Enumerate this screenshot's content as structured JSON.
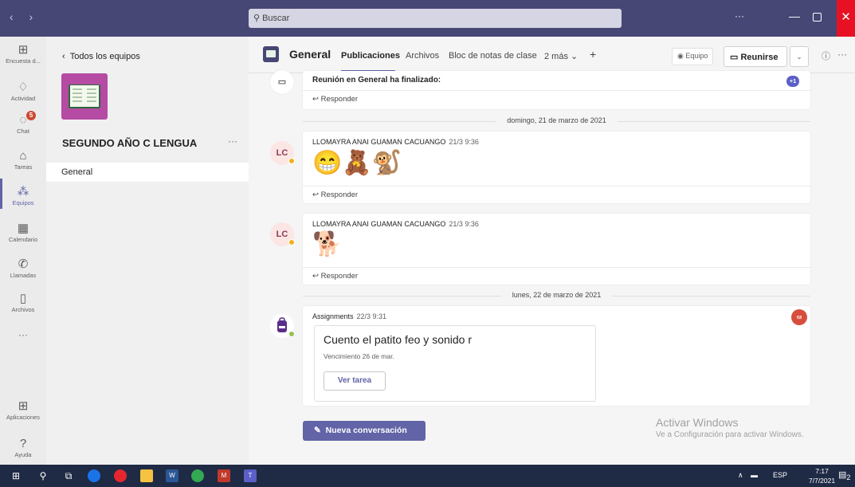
{
  "titlebar": {
    "nav": "‹ ›",
    "search_placeholder": "Buscar",
    "dots": "···",
    "minimize": "—",
    "close": "✕"
  },
  "rail": {
    "items": [
      {
        "label": "Encuesta d...",
        "icon": "apps-grid-icon"
      },
      {
        "label": "Actividad",
        "icon": "bell-icon"
      },
      {
        "label": "Chat",
        "icon": "chat-icon",
        "badge": "5"
      },
      {
        "label": "Tareas",
        "icon": "backpack-icon"
      },
      {
        "label": "Equipos",
        "icon": "teams-icon"
      },
      {
        "label": "Calendario",
        "icon": "calendar-icon"
      },
      {
        "label": "Llamadas",
        "icon": "phone-icon"
      },
      {
        "label": "Archivos",
        "icon": "file-icon"
      },
      {
        "label": "···",
        "icon": "more-icon"
      },
      {
        "label": "Aplicaciones",
        "icon": "apps-icon"
      },
      {
        "label": "Ayuda",
        "icon": "help-icon"
      }
    ]
  },
  "sidebar": {
    "back_label": "Todos los equipos",
    "team_name": "SEGUNDO AÑO C LENGUA",
    "more": "···",
    "channel": "General"
  },
  "header": {
    "title": "General",
    "tabs": [
      "Publicaciones",
      "Archivos",
      "Bloc de notas de clase",
      "2 más ⌄",
      "+"
    ],
    "team_button": "Equipo",
    "meet_button": "Reunirse",
    "info": "ⓘ",
    "more": "···"
  },
  "feed": {
    "meeting_post": {
      "text": "Reunión en General ha finalizado:",
      "count_badge": "+1",
      "reply": "Responder"
    },
    "date1": "domingo, 21 de marzo de 2021",
    "post1": {
      "initials": "LC",
      "author": "LLOMAYRA ANAI GUAMAN CACUANGO",
      "time": "21/3 9:36",
      "emojis": "😁🧸🐒",
      "reply": "Responder"
    },
    "post2": {
      "initials": "LC",
      "author": "LLOMAYRA ANAI GUAMAN CACUANGO",
      "time": "21/3 9:36",
      "emojis": "🐕",
      "reply": "Responder"
    },
    "date2": "lunes, 22 de marzo de 2021",
    "assignment": {
      "author": "Assignments",
      "time": "22/3 9:31",
      "title": "Cuento el patito feo y sonido r",
      "due": "Vencimiento 26 de mar.",
      "button": "Ver tarea"
    }
  },
  "compose": {
    "new_conversation": "Nueva conversación"
  },
  "watermark": {
    "line1": "Activar Windows",
    "line2": "Ve a Configuración para activar Windows."
  },
  "taskbar": {
    "lang": "ESP",
    "time": "7:17",
    "date": "7/7/2021",
    "notif": "2"
  }
}
